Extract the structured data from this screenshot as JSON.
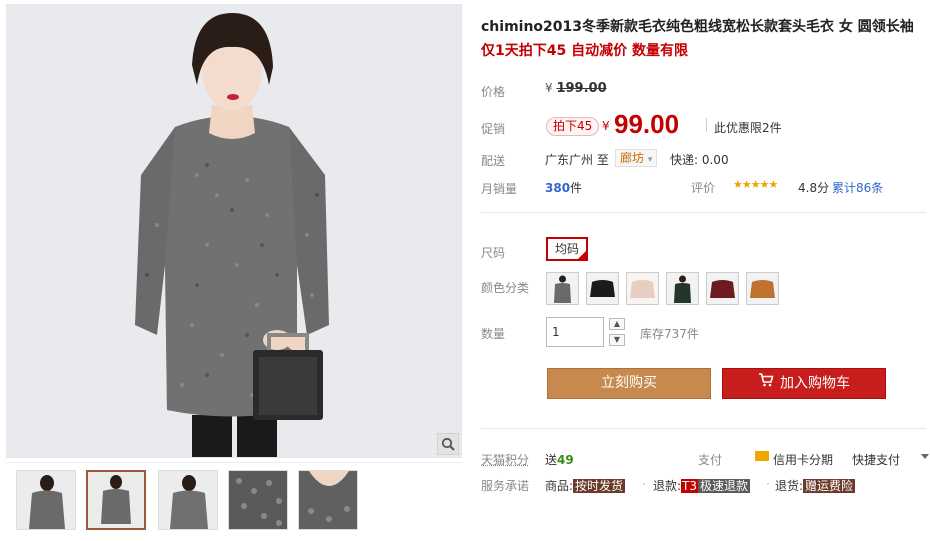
{
  "product": {
    "title": "chimino2013冬季新款毛衣纯色粗线宽松长款套头毛衣 女 圆领长袖",
    "subtitle": "仅1天拍下45 自动减价 数量有限"
  },
  "price": {
    "label": "价格",
    "currency": "¥",
    "original": "199.00"
  },
  "promo": {
    "label": "促销",
    "tag": "拍下45",
    "currency": "¥",
    "price": "99.00",
    "limit_note": "此优惠限2件"
  },
  "shipping": {
    "label": "配送",
    "from": "广东广州 至",
    "destination": "廊坊",
    "fee": "快递: 0.00"
  },
  "sales": {
    "label": "月销量",
    "count": "380",
    "unit": "件",
    "rating_label": "评价",
    "stars": "★★★★★",
    "score": "4.8分",
    "reviews": "累计86条"
  },
  "size": {
    "label": "尺码",
    "selected": "均码"
  },
  "color": {
    "label": "颜色分类",
    "swatches": [
      {
        "name": "gray-marl",
        "color": "#6a6a6a"
      },
      {
        "name": "black",
        "color": "#1b1b1b"
      },
      {
        "name": "beige",
        "color": "#e6cfc1"
      },
      {
        "name": "dark-green",
        "color": "#25352a"
      },
      {
        "name": "burgundy",
        "color": "#6e1a22"
      },
      {
        "name": "camel",
        "color": "#c0702f"
      }
    ]
  },
  "quantity": {
    "label": "数量",
    "value": "1",
    "stock": "库存737件"
  },
  "actions": {
    "buy_now": "立刻购买",
    "add_to_cart": "加入购物车"
  },
  "points": {
    "label": "天猫积分",
    "prefix": "送",
    "value": "49"
  },
  "payment": {
    "label": "支付",
    "installment": "信用卡分期",
    "quickpay": "快捷支付"
  },
  "service": {
    "label": "服务承诺",
    "items": [
      {
        "prefix": "商品:",
        "tag": "按时发货"
      },
      {
        "prefix": "退款:",
        "tag_t3": "T3",
        "tag": "极速退款"
      },
      {
        "prefix": "退货:",
        "tag": "赠运费险"
      }
    ]
  },
  "colors": {
    "price_red": "#c40000",
    "buy_button": "#c6894e",
    "cart_button": "#c81d1d",
    "link_blue": "#3366cc"
  }
}
